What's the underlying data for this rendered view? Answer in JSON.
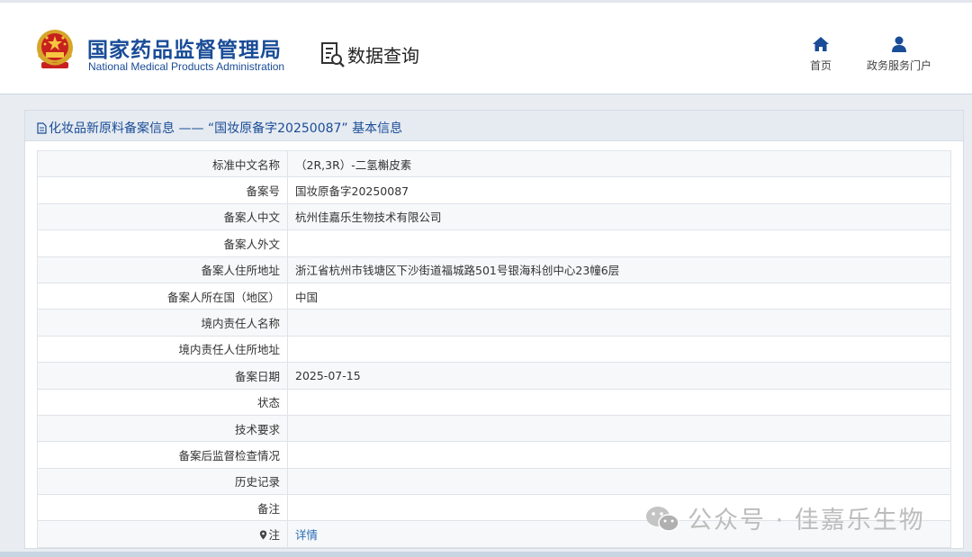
{
  "header": {
    "org_name_cn": "国家药品监督管理局",
    "org_name_en": "National Medical Products Administration",
    "query_title": "数据查询",
    "nav": {
      "home_label": "首页",
      "portal_label": "政务服务门户"
    }
  },
  "panel": {
    "title": "化妆品新原料备案信息 —— “国妆原备字20250087” 基本信息"
  },
  "rows": [
    {
      "label": "标准中文名称",
      "value": "（2R,3R）-二氢槲皮素"
    },
    {
      "label": "备案号",
      "value": "国妆原备字20250087"
    },
    {
      "label": "备案人中文",
      "value": "杭州佳嘉乐生物技术有限公司"
    },
    {
      "label": "备案人外文",
      "value": ""
    },
    {
      "label": "备案人住所地址",
      "value": "浙江省杭州市钱塘区下沙街道福城路501号银海科创中心23幢6层"
    },
    {
      "label": "备案人所在国（地区）",
      "value": "中国"
    },
    {
      "label": "境内责任人名称",
      "value": ""
    },
    {
      "label": "境内责任人住所地址",
      "value": ""
    },
    {
      "label": "备案日期",
      "value": "2025-07-15"
    },
    {
      "label": "状态",
      "value": ""
    },
    {
      "label": "技术要求",
      "value": ""
    },
    {
      "label": "备案后监督检查情况",
      "value": ""
    },
    {
      "label": "历史记录",
      "value": ""
    },
    {
      "label": "备注",
      "value": ""
    },
    {
      "label": "注",
      "value": "详情"
    }
  ],
  "watermark": {
    "text": "公众号 · 佳嘉乐生物"
  },
  "icons": {
    "emblem": "national-emblem-icon",
    "query": "data-query-icon",
    "home": "home-icon",
    "portal": "user-icon",
    "doc": "document-icon",
    "pin": "location-pin-icon",
    "wechat": "wechat-icon"
  },
  "colors": {
    "brand_blue": "#1a4c97",
    "link_blue": "#2a6db5",
    "panel_header": "#e6ebf1"
  }
}
